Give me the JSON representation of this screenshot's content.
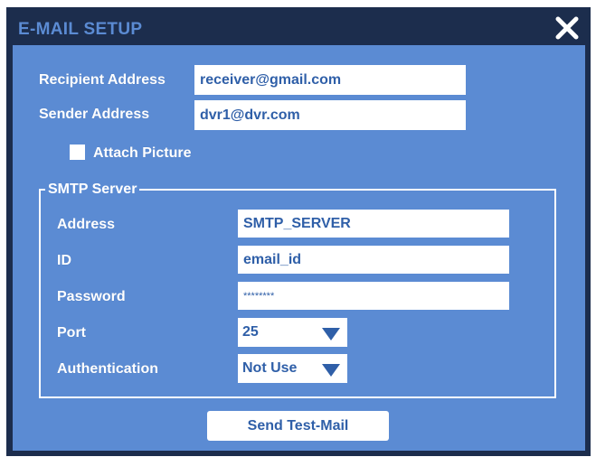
{
  "dialog": {
    "title": "E-MAIL SETUP",
    "close_icon": "close-icon"
  },
  "form": {
    "recipient_label": "Recipient Address",
    "recipient_value": "receiver@gmail.com",
    "sender_label": "Sender Address",
    "sender_value": "dvr1@dvr.com",
    "attach_label": "Attach Picture",
    "attach_checked": false
  },
  "smtp": {
    "legend": "SMTP Server",
    "address_label": "Address",
    "address_value": "SMTP_SERVER",
    "id_label": "ID",
    "id_value": "email_id",
    "password_label": "Password",
    "password_value": "********",
    "port_label": "Port",
    "port_value": "25",
    "auth_label": "Authentication",
    "auth_value": "Not Use"
  },
  "actions": {
    "send_test_label": "Send Test-Mail"
  },
  "colors": {
    "frame": "#1c2d4d",
    "panel": "#5b8bd3",
    "field_text": "#2f5fa8",
    "arrow": "#2f5fa8"
  }
}
